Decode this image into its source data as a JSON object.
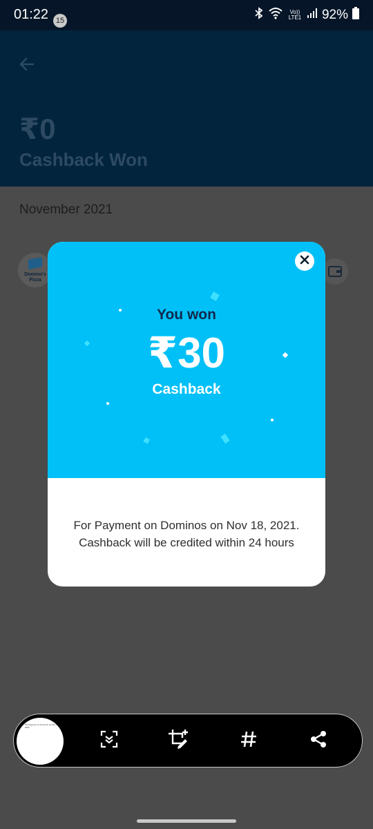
{
  "status_bar": {
    "time": "01:22",
    "notification_count": "15",
    "network_label": "Vo)) LTE1",
    "battery": "92%"
  },
  "header": {
    "amount": "₹0",
    "label": "Cashback Won"
  },
  "list": {
    "month": "November 2021",
    "merchant_logo_text": "Domino's Pizza"
  },
  "modal": {
    "heading": "You won",
    "amount": "₹30",
    "subheading": "Cashback",
    "description_line1": "For Payment on Dominos on Nov 18, 2021.",
    "description_line2": "Cashback will be credited within 24 hours"
  },
  "toolbar": {
    "thumbnail_caption": "For Payment on Dominos on Nov 18, 2021",
    "tools": [
      "scroll-capture-icon",
      "crop-edit-icon",
      "hashtag-icon",
      "share-icon"
    ]
  },
  "colors": {
    "modal_accent": "#00c0f7",
    "header_bg": "#02243d",
    "overlay": "#4b4b4b"
  }
}
